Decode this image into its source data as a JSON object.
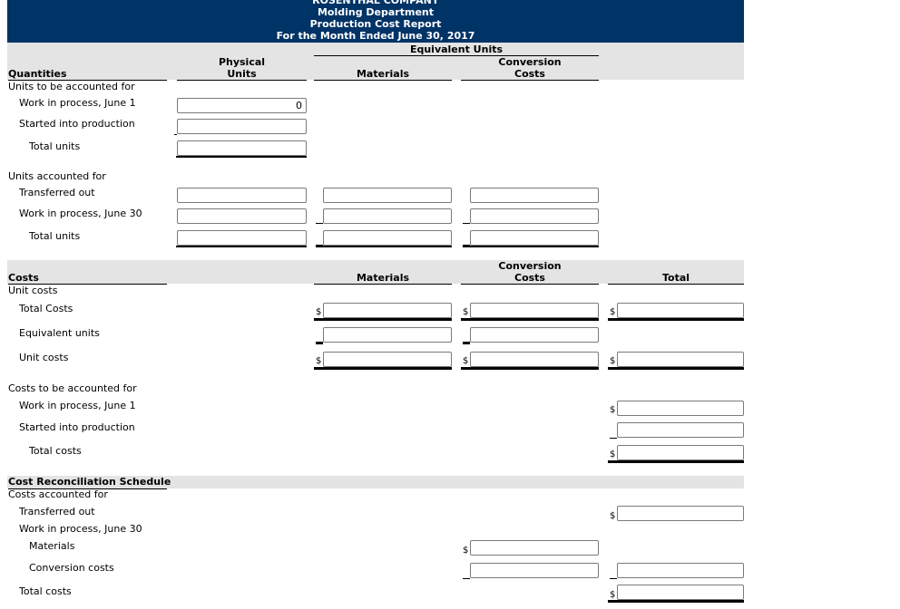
{
  "header": {
    "company": "ROSENTHAL COMPANY",
    "department": "Molding Department",
    "report": "Production Cost Report",
    "period": "For the Month Ended June 30, 2017"
  },
  "quantities": {
    "section_label": "Quantities",
    "col_physical": [
      "Physical",
      "Units"
    ],
    "col_equivalent": "Equivalent Units",
    "col_materials": "Materials",
    "col_conversion": [
      "Conversion",
      "Costs"
    ],
    "to_be_accounted_label": "Units to be accounted for",
    "rows_to_be": [
      {
        "label": "Work in process, June 1",
        "physical": "0"
      },
      {
        "label": "Started into production",
        "physical": ""
      },
      {
        "label": "Total units",
        "physical": ""
      }
    ],
    "accounted_label": "Units accounted for",
    "rows_accounted": [
      {
        "label": "Transferred out",
        "physical": "",
        "materials": "",
        "conversion": ""
      },
      {
        "label": "Work in process, June 30",
        "physical": "",
        "materials": "",
        "conversion": ""
      },
      {
        "label": "Total units",
        "physical": "",
        "materials": "",
        "conversion": ""
      }
    ]
  },
  "costs": {
    "section_label": "Costs",
    "col_materials": "Materials",
    "col_conversion": [
      "Conversion",
      "Costs"
    ],
    "col_total": "Total",
    "unit_costs_label": "Unit costs",
    "rows_unit": [
      {
        "label": "Total Costs",
        "materials": "",
        "conversion": "",
        "total": ""
      },
      {
        "label": "Equivalent units",
        "materials": "",
        "conversion": ""
      },
      {
        "label": "Unit costs",
        "materials": "",
        "conversion": "",
        "total": ""
      }
    ],
    "to_be_accounted_label": "Costs to be accounted for",
    "rows_to_be": [
      {
        "label": "Work in process, June 1",
        "total": ""
      },
      {
        "label": "Started into production",
        "total": ""
      },
      {
        "label": "Total costs",
        "total": ""
      }
    ]
  },
  "reconciliation": {
    "section_label": "Cost Reconciliation Schedule",
    "accounted_label": "Costs accounted for",
    "transferred_out": {
      "label": "Transferred out",
      "total": ""
    },
    "wip_label": "Work in process, June 30",
    "materials": {
      "label": "Materials",
      "conversion_col": ""
    },
    "conversion_costs": {
      "label": "Conversion costs",
      "conversion_col": "",
      "total": ""
    },
    "total_costs": {
      "label": "Total costs",
      "total": ""
    }
  },
  "currency_symbol": "$"
}
